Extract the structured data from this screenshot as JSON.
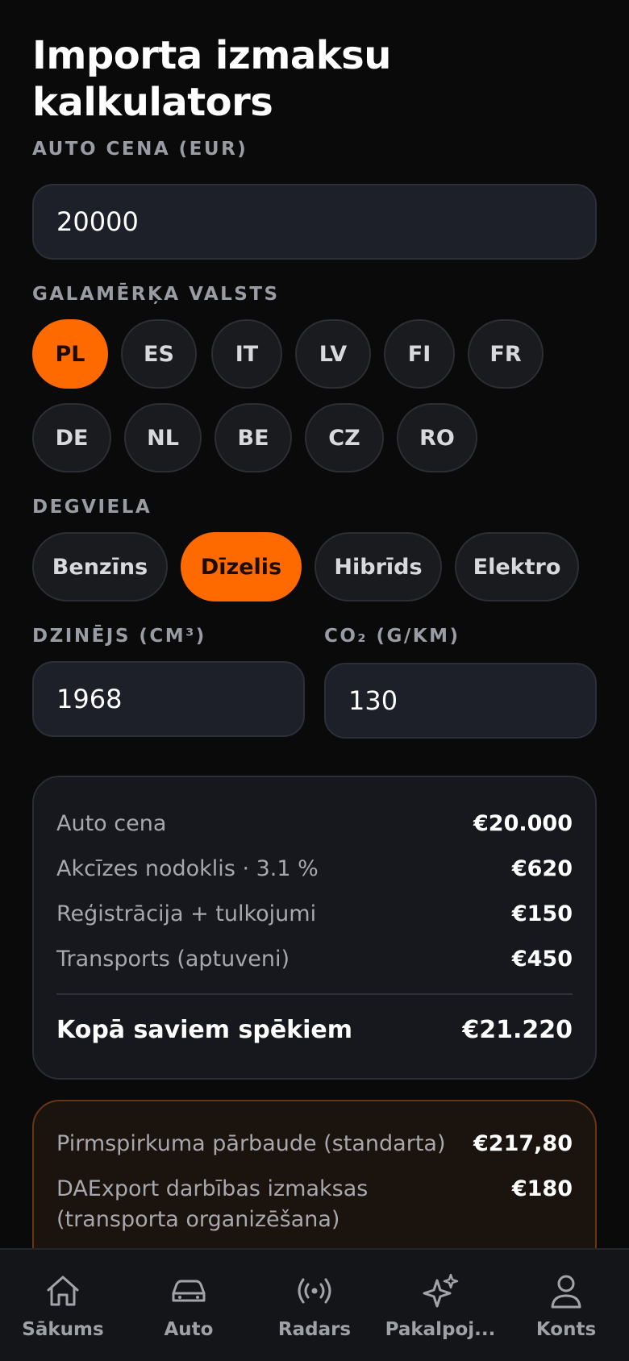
{
  "header": {
    "title": "Importa izmaksu kalkulators"
  },
  "price": {
    "label": "AUTO CENA (EUR)",
    "value": "20000"
  },
  "country": {
    "label": "GALAMĒRĶA VALSTS",
    "options": [
      "PL",
      "ES",
      "IT",
      "LV",
      "FI",
      "FR",
      "DE",
      "NL",
      "BE",
      "CZ",
      "RO"
    ],
    "selected": "PL"
  },
  "fuel": {
    "label": "DEGVIELA",
    "options": [
      "Benzīns",
      "Dīzelis",
      "Hibrīds",
      "Elektro"
    ],
    "selected": "Dīzelis"
  },
  "engine": {
    "label": "DZINĒJS (CM³)",
    "value": "1968"
  },
  "co2": {
    "label": "CO₂ (G/KM)",
    "value": "130"
  },
  "summary": {
    "rows": [
      {
        "label": "Auto cena",
        "value": "€20.000"
      },
      {
        "label": "Akcīzes nodoklis · 3.1 %",
        "value": "€620"
      },
      {
        "label": "Reģistrācija + tulkojumi",
        "value": "€150"
      },
      {
        "label": "Transports (aptuveni)",
        "value": "€450"
      }
    ],
    "total_label": "Kopā saviem spēkiem",
    "total_value": "€21.220"
  },
  "services": {
    "rows": [
      {
        "label": "Pirmspirkuma pārbaude (standarta)",
        "value": "€217,80"
      },
      {
        "label": "DAExport darbības izmaksas (transporta organizēšana)",
        "value": "€180"
      }
    ]
  },
  "nav": {
    "items": [
      {
        "label": "Sākums",
        "icon": "home-icon"
      },
      {
        "label": "Auto",
        "icon": "car-icon"
      },
      {
        "label": "Radars",
        "icon": "radar-icon"
      },
      {
        "label": "Pakalpoj...",
        "icon": "sparkles-icon"
      },
      {
        "label": "Konts",
        "icon": "user-icon"
      }
    ]
  },
  "colors": {
    "accent": "#ff6a00",
    "background": "#0a0a0b",
    "card": "#16181d"
  }
}
